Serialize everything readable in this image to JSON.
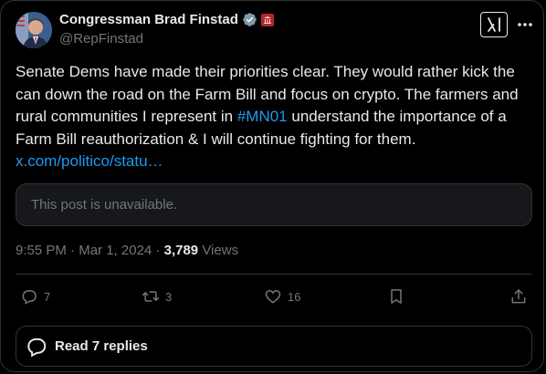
{
  "author": {
    "display_name": "Congressman Brad Finstad",
    "handle": "@RepFinstad",
    "verified": true,
    "affiliation_badge": "us-congress-badge"
  },
  "post": {
    "text_before_hashtag": "Senate Dems have made their priorities clear. They would rather kick the can down the road on the Farm Bill and focus on crypto. The farmers and rural communities I represent in ",
    "hashtag": "#MN01",
    "text_after_hashtag": " understand the importance of a Farm Bill reauthorization & I will continue fighting for them.",
    "link": "x.com/politico/statu…"
  },
  "quoted_post": {
    "unavailable_text": "This post is unavailable."
  },
  "meta": {
    "time": "9:55 PM",
    "separator": "·",
    "date": "Mar 1, 2024",
    "views_count": "3,789",
    "views_label": "Views"
  },
  "actions": {
    "replies": "7",
    "reposts": "3",
    "likes": "16"
  },
  "footer": {
    "read_replies": "Read 7 replies"
  },
  "colors": {
    "accent": "#1d9bf0",
    "verified": "#829aab",
    "text": "#e7e9ea",
    "muted": "#71767b",
    "border": "#2f3336"
  }
}
